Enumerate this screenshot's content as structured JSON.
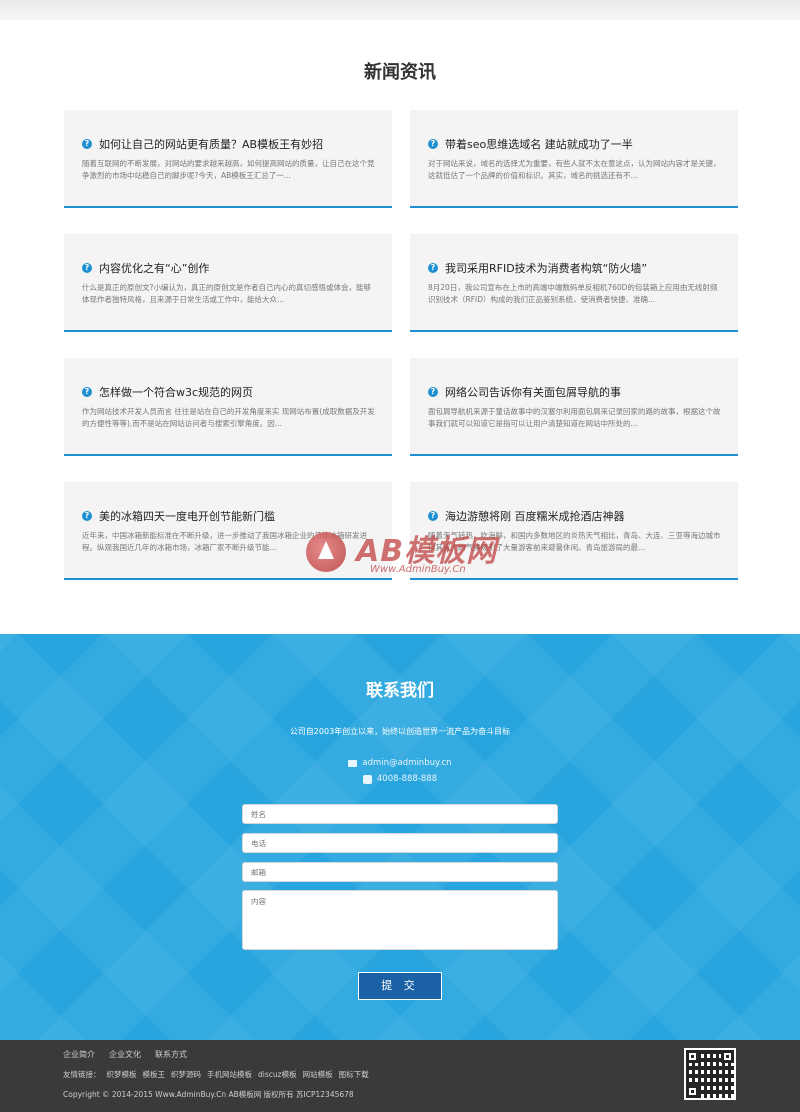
{
  "news": {
    "section_title": "新闻资讯",
    "items": [
      {
        "title": "如何让自己的网站更有质量？AB模板王有妙招",
        "desc": "随着互联网的不断发展，对网站的要求越来越高，如何提高网站的质量，让自己在这个竞争激烈的市场中站稳自己的脚步呢?今天，AB模板王汇总了一..."
      },
      {
        "title": "带着seo思维选域名 建站就成功了一半",
        "desc": "对于网站来说，域名的选择尤为重要，有些人就不太在意这点，认为网站内容才是关键，这就低估了一个品牌的价值和标识。其实，域名的挑选还有不..."
      },
      {
        "title": "内容优化之有“心”创作",
        "desc": "什么是真正的原创文?小编认为，真正的原创文是作者自己内心的真切感悟或体会，能够体现作者独特风格，且来源于日常生活或工作中，能给大众..."
      },
      {
        "title": "我司采用RFID技术为消费者构筑“防火墙”",
        "desc": "8月20日，我公司宣布在上市的高端中端数码单反相机760D的包装箱上应用由无线射频识别技术（RFID）构成的我们正品鉴别系统，使消费者快捷、准确..."
      },
      {
        "title": "怎样做一个符合w3c规范的网页",
        "desc": "作为网站技术开发人员而言 往往是站在自己的开发角度来实 现网站布置(成取数据及开发的方便性等等),而不是站在网站访问者与搜索引擎角度。因..."
      },
      {
        "title": "网络公司告诉你有关面包屑导航的事",
        "desc": "面包屑导航机来源于童话故事中的汉塞尔利用面包屑来记录回家的路的故事，根据这个故事我们就可以知道它是指可以让用户清楚知道在网站中所处的..."
      },
      {
        "title": "美的冰箱四天一度电开创节能新门槛",
        "desc": "近年来，中国冰箱新能标准在不断升级，进一步推动了我国冰箱企业的节能冰箱研发进程。纵观我国近几年的冰箱市场，冰箱厂家不断升级节能..."
      },
      {
        "title": "海边游憩将刚 百度糯米成抢酒店神器",
        "desc": "随着天气转热，吃海鲜，和国内多数地区的炎热天气相比，青岛、大连、三亚等海边城市以其宜人的气候吸引了大量游客前来避暑休闲。青岛旅游局的最..."
      }
    ]
  },
  "watermark": {
    "text": "AB模板网",
    "sub": "Www.AdminBuy.Cn"
  },
  "contact": {
    "title": "联系我们",
    "slogan": "公司自2003年创立以来，始终以创造世界一流产品为奋斗目标",
    "email": "admin@adminbuy.cn",
    "phone": "4008-888-888",
    "form": {
      "name_placeholder": "姓名",
      "phone_placeholder": "电话",
      "email_placeholder": "邮箱",
      "content_placeholder": "内容",
      "submit_label": "提 交"
    }
  },
  "footer": {
    "links": [
      "企业简介",
      "企业文化",
      "联系方式"
    ],
    "friend_label": "友情链接：",
    "friend_links": [
      "织梦模板",
      "模板王",
      "织梦源码",
      "手机网站模板",
      "discuz模板",
      "网站模板",
      "图标下载"
    ],
    "copyright": "Copyright © 2014-2015 Www.AdminBuy.Cn AB模板网 版权所有   苏ICP12345678"
  },
  "colors": {
    "accent": "#1e90d2",
    "contact_bg": "#28a5de",
    "footer_bg": "#3a3a3a",
    "submit_bg": "#1a62a5"
  }
}
